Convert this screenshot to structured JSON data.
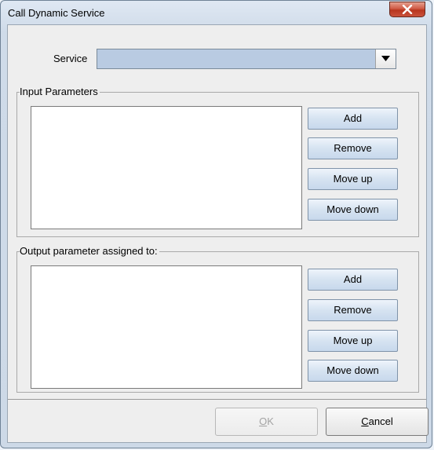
{
  "window": {
    "title": "Call Dynamic Service",
    "close_glyph": "✕"
  },
  "service": {
    "label": "Service",
    "value": ""
  },
  "input_group": {
    "title": "Input Parameters",
    "buttons": {
      "add": "Add",
      "remove": "Remove",
      "move_up": "Move up",
      "move_down": "Move down"
    }
  },
  "output_group": {
    "title": "Output parameter assigned to:",
    "buttons": {
      "add": "Add",
      "remove": "Remove",
      "move_up": "Move up",
      "move_down": "Move down"
    }
  },
  "footer": {
    "ok": {
      "mnemonic": "O",
      "rest": "K",
      "enabled": false
    },
    "cancel": {
      "mnemonic": "C",
      "rest": "ancel"
    }
  }
}
